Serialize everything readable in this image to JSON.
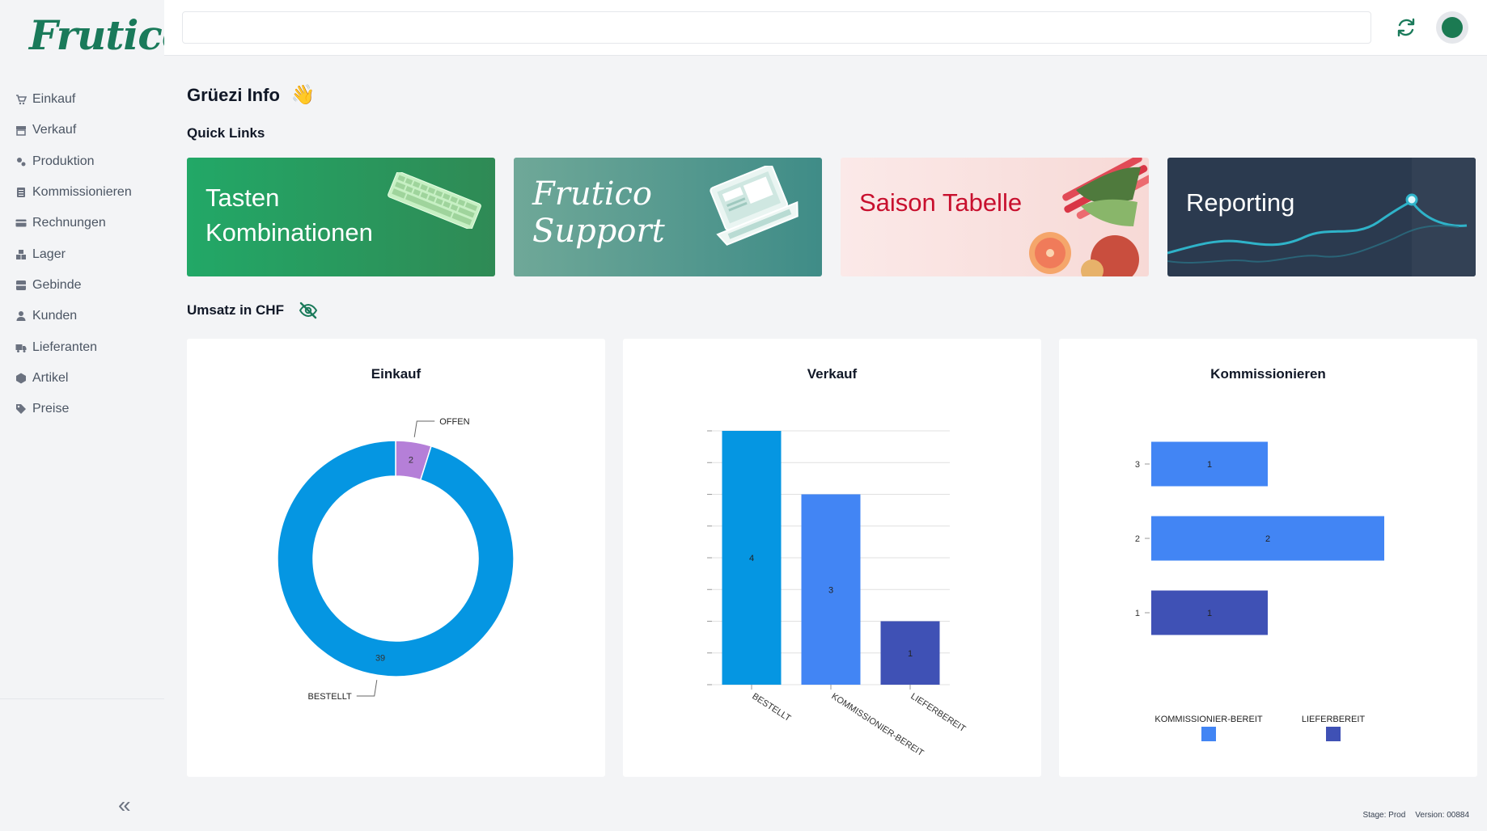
{
  "app": {
    "logo": "Frutico"
  },
  "sidebar": {
    "items": [
      {
        "label": "Einkauf",
        "icon": "cart-icon"
      },
      {
        "label": "Verkauf",
        "icon": "store-icon"
      },
      {
        "label": "Produktion",
        "icon": "cogs-icon"
      },
      {
        "label": "Kommissionieren",
        "icon": "clipboard-icon"
      },
      {
        "label": "Rechnungen",
        "icon": "credit-card-icon"
      },
      {
        "label": "Lager",
        "icon": "boxes-icon"
      },
      {
        "label": "Gebinde",
        "icon": "crate-icon"
      },
      {
        "label": "Kunden",
        "icon": "user-icon"
      },
      {
        "label": "Lieferanten",
        "icon": "truck-icon"
      },
      {
        "label": "Artikel",
        "icon": "hexagon-icon"
      },
      {
        "label": "Preise",
        "icon": "tag-icon"
      }
    ],
    "collapse_icon": "double-chevron-left-icon"
  },
  "header": {
    "search_placeholder": "",
    "refresh_icon": "refresh-icon",
    "avatar_icon": "apple-avatar-icon"
  },
  "greeting": {
    "text": "Grüezi Info",
    "emoji": "👋"
  },
  "quick_links": {
    "title": "Quick Links",
    "cards": [
      {
        "line1": "Tasten",
        "line2": "Kombinationen"
      },
      {
        "line1": "Frutico",
        "line2": "Support"
      },
      {
        "line1": "Saison Tabelle"
      },
      {
        "line1": "Reporting"
      }
    ]
  },
  "revenue": {
    "title": "Umsatz in CHF",
    "toggle_icon": "eye-off-icon"
  },
  "colors": {
    "brand": "#1a7a5a",
    "blue": "#0596e2",
    "mid_blue": "#4285f4",
    "dark_blue": "#3f51b5",
    "purple": "#b57fd8"
  },
  "chart_data": [
    {
      "type": "pie",
      "title": "Einkauf",
      "labels": [
        "OFFEN",
        "BESTELLT"
      ],
      "values": [
        2,
        39
      ],
      "colors": [
        "#b57fd8",
        "#0596e2"
      ]
    },
    {
      "type": "bar",
      "title": "Verkauf",
      "categories": [
        "BESTELLT",
        "KOMMISSIONIER-BEREIT",
        "LIEFERBEREIT"
      ],
      "values": [
        4,
        3,
        1
      ],
      "colors": [
        "#0596e2",
        "#4285f4",
        "#3f51b5"
      ],
      "ylim": [
        0,
        4
      ]
    },
    {
      "type": "bar",
      "orientation": "horizontal",
      "title": "Kommissionieren",
      "categories": [
        "3",
        "2",
        "1"
      ],
      "values": [
        1,
        2,
        1
      ],
      "colors": [
        "#4285f4",
        "#4285f4",
        "#3f51b5"
      ],
      "legend": [
        "KOMMISSIONIER-BEREIT",
        "LIEFERBEREIT"
      ],
      "legend_colors": [
        "#4285f4",
        "#3f51b5"
      ]
    }
  ],
  "footer": {
    "stage": "Stage: Prod",
    "version": "Version: 00884"
  }
}
